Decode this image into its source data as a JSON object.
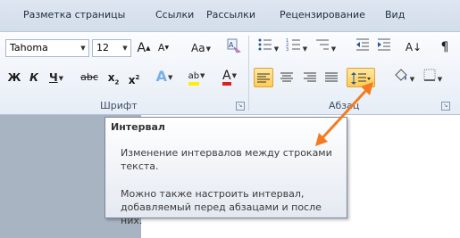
{
  "tabs": [
    "Разметка страницы",
    "Ссылки",
    "Рассылки",
    "Рецензирование",
    "Вид"
  ],
  "font": {
    "name": "Tahoma",
    "size": "12",
    "buttons": {
      "grow": "A",
      "shrink": "A",
      "case": "Aa",
      "bold": "Ж",
      "italic": "К",
      "underline": "Ч",
      "strike": "abc",
      "subscript": "x",
      "superscript": "x",
      "effects": "A",
      "highlight": "ab",
      "color": "A"
    },
    "group_label": "Шрифт"
  },
  "paragraph": {
    "group_label": "Абзац",
    "sort_symbol": "A↓",
    "marks_symbol": "¶"
  },
  "tooltip": {
    "title": "Интервал",
    "line1": "Изменение интервалов между строками",
    "line2": "текста.",
    "line3": "Можно также настроить интервал,",
    "line4": "добавляемый перед абзацами и после них."
  },
  "colors": {
    "arrow": "#f47b20",
    "highlight_yellow": "#ffef00",
    "font_color_red": "#e02020",
    "active_button": "#ffcc50"
  }
}
